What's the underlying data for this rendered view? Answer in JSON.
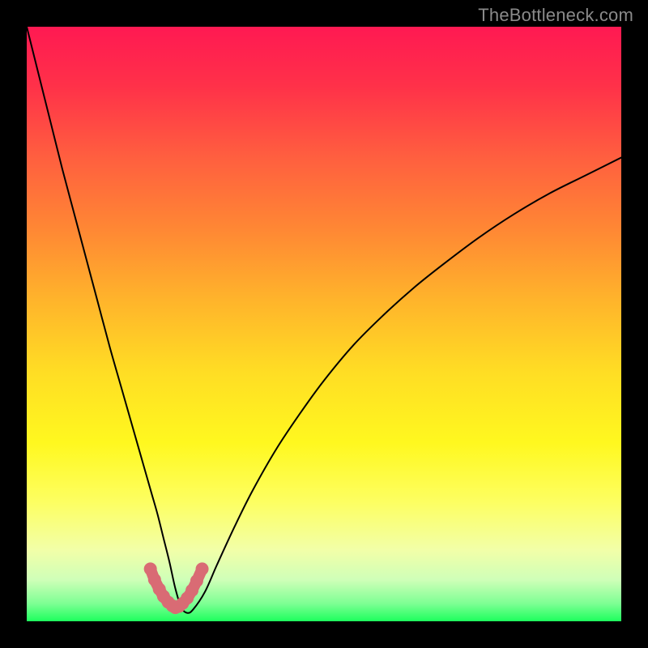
{
  "watermark": "TheBottleneck.com",
  "chart_data": {
    "type": "line",
    "title": "",
    "xlabel": "",
    "ylabel": "",
    "xlim": [
      0,
      100
    ],
    "ylim": [
      0,
      100
    ],
    "grid": false,
    "series": [
      {
        "name": "curve",
        "x": [
          0,
          2,
          4,
          6,
          8,
          10,
          12,
          14,
          16,
          18,
          20,
          21,
          22,
          23,
          24,
          25,
          26,
          27,
          28,
          30,
          32,
          35,
          38,
          42,
          46,
          50,
          55,
          60,
          65,
          70,
          76,
          82,
          88,
          94,
          100
        ],
        "y": [
          100,
          92,
          84,
          76,
          68.5,
          61,
          53.5,
          46,
          39,
          32,
          25,
          21.5,
          18,
          14,
          10,
          5.5,
          2.3,
          1.4,
          2.0,
          5.0,
          9.5,
          16,
          22,
          29,
          35,
          40.5,
          46.5,
          51.5,
          56,
          60,
          64.5,
          68.5,
          72,
          75,
          78
        ]
      },
      {
        "name": "pink-marker",
        "x": [
          20.8,
          21.5,
          22.3,
          23.0,
          23.8,
          24.5,
          25.0,
          25.6,
          26.2,
          27.0,
          27.8,
          28.6,
          29.5
        ],
        "y": [
          8.8,
          7.0,
          5.4,
          4.2,
          3.2,
          2.6,
          2.3,
          2.5,
          3.0,
          3.9,
          5.2,
          6.8,
          8.8
        ]
      }
    ],
    "background_gradient": {
      "0.00": "#ff1952",
      "0.10": "#ff3149",
      "0.22": "#ff5f3f",
      "0.34": "#ff8734",
      "0.46": "#ffb42b",
      "0.58": "#ffdd24",
      "0.70": "#fff81f",
      "0.80": "#fdff62",
      "0.88": "#f2ffa8",
      "0.93": "#cfffb8",
      "0.97": "#7eff94",
      "1.00": "#1dff5d"
    },
    "colors": {
      "curve": "#000000",
      "pink-marker": "#d96b74"
    }
  }
}
